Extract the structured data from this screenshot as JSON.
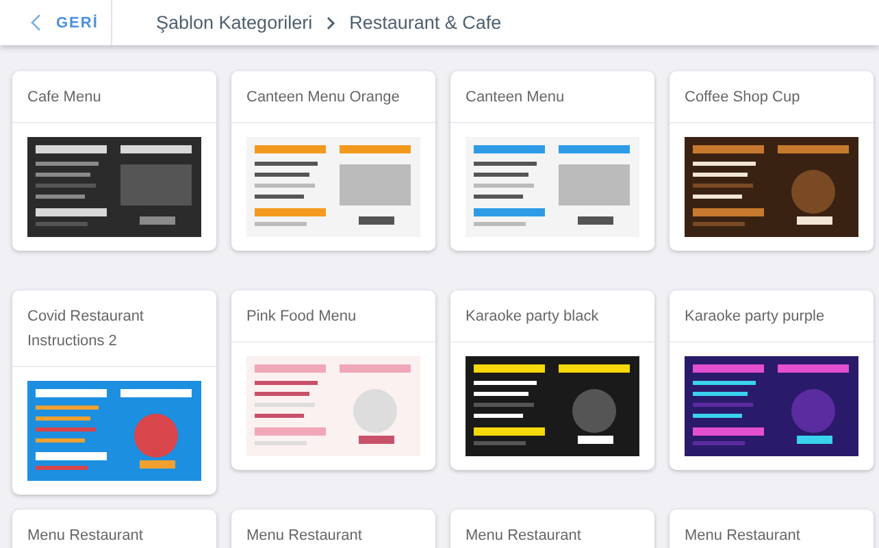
{
  "header": {
    "back_button": "GERİ",
    "breadcrumb": [
      "Şablon Kategorileri",
      "Restaurant & Cafe"
    ]
  },
  "cards": [
    {
      "title": "Cafe Menu"
    },
    {
      "title": "Canteen Menu Orange"
    },
    {
      "title": "Canteen Menu"
    },
    {
      "title": "Coffee Shop Cup"
    },
    {
      "title": "Covid Restaurant Instructions 2"
    },
    {
      "title": "Pink Food Menu"
    },
    {
      "title": "Karaoke party black"
    },
    {
      "title": "Karaoke party purple"
    },
    {
      "title": "Menu Restaurant"
    },
    {
      "title": "Menu Restaurant"
    },
    {
      "title": "Menu Restaurant"
    },
    {
      "title": "Menu Restaurant"
    }
  ]
}
